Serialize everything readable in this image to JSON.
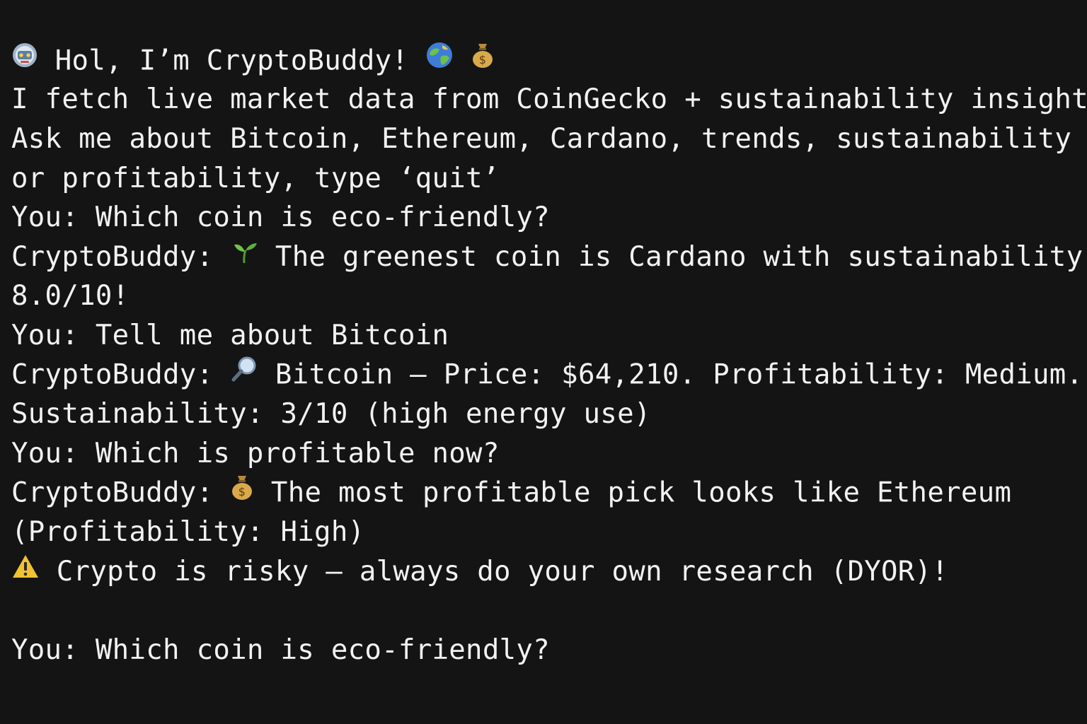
{
  "terminal": {
    "greeting": {
      "icon": "robot-icon",
      "text": " Hol, I’m CryptoBuddy! ",
      "globe_icon": "globe-icon",
      "money_icon": "money-bag-icon"
    },
    "intro_line_1": "I fetch live market data from CoinGecko + sustainability insights.",
    "intro_line_2": "Ask me about Bitcoin, Ethereum, Cardano, trends, sustainability",
    "intro_line_3": "or profitability, type ‘quit’",
    "exchanges": [
      {
        "user": "You: Which coin is eco-friendly?",
        "bot_prefix": "CryptoBuddy: ",
        "bot_icon": "seedling-icon",
        "bot_text": " The greenest coin is Cardano with sustainability",
        "bot_cont": "8.0/10!"
      },
      {
        "user": "You: Tell me about Bitcoin",
        "bot_prefix": "CryptoBuddy: ",
        "bot_icon": "magnifier-icon",
        "bot_text": " Bitcoin – Price: $64,210. Profitability: Medium.",
        "bot_cont": "Sustainability: 3/10 (high energy use)"
      },
      {
        "user": "You: Which is profitable now?",
        "bot_prefix": "CryptoBuddy: ",
        "bot_icon": "money-bag-icon",
        "bot_text": " The most profitable pick looks like Ethereum",
        "bot_cont": "(Profitability: High)"
      }
    ],
    "warning": {
      "icon": "warning-icon",
      "text": " Crypto is risky – always do your own research (DYOR)!"
    },
    "current_input": "You: Which coin is eco-friendly?",
    "colors": {
      "background": "#141414",
      "foreground": "#f2f2f2"
    }
  }
}
